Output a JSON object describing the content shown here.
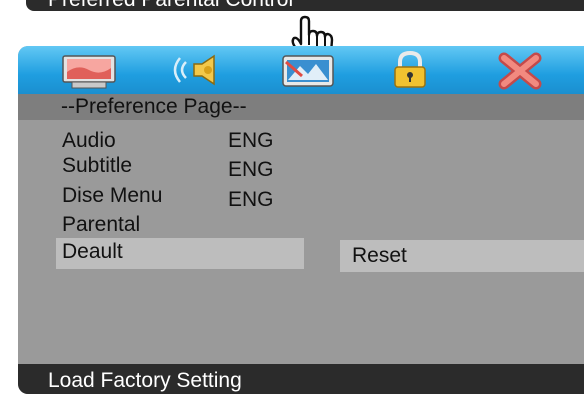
{
  "top_banner": {
    "text": "Preferred Parental Control"
  },
  "tabs": [
    {
      "icon": "monitor-icon",
      "label": ""
    },
    {
      "icon": "speaker-icon",
      "label": ""
    },
    {
      "icon": "picture-icon",
      "label": ""
    },
    {
      "icon": "lock-icon",
      "label": ""
    },
    {
      "icon": "close-icon",
      "label": ""
    }
  ],
  "preference_page": {
    "title": "--Preference Page--",
    "items": [
      {
        "label": "Audio",
        "value": "ENG"
      },
      {
        "label": "Subtitle",
        "value": "ENG"
      },
      {
        "label": "Dise Menu",
        "value": "ENG"
      },
      {
        "label": "Parental",
        "value": ""
      },
      {
        "label": "Deault",
        "value": ""
      }
    ],
    "selected_option": "Reset"
  },
  "status_bar": {
    "text": "Load Factory Setting"
  },
  "colors": {
    "tab_bar": "#1f9ee0",
    "panel": "#9a9a9a",
    "header": "#7e7e7e",
    "selection": "#bdbdbd",
    "status_bar": "#2b2b2b"
  }
}
